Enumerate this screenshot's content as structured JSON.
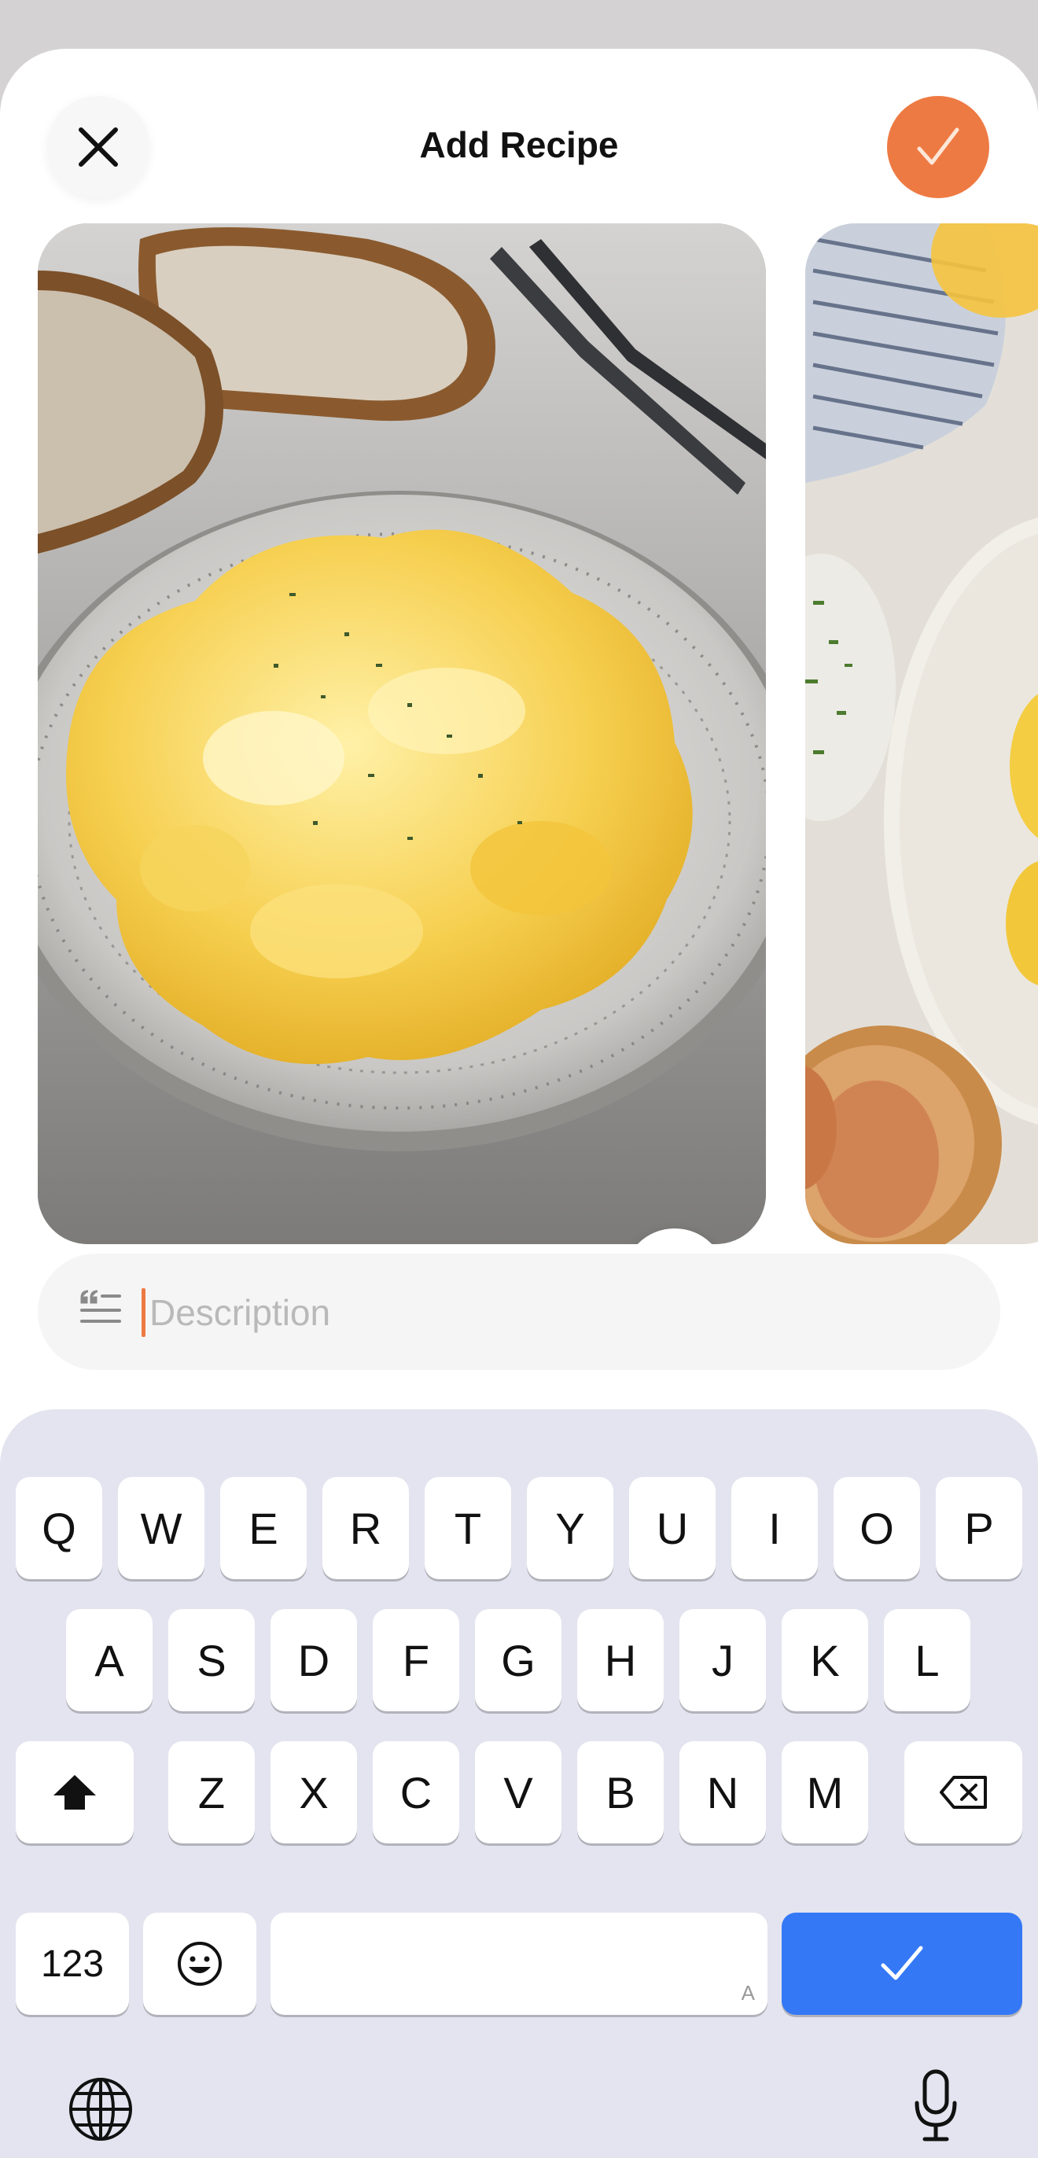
{
  "header": {
    "title": "Add Recipe",
    "close_icon": "close-icon",
    "confirm_icon": "checkmark-icon",
    "accent": "#ee7a43"
  },
  "photos": [
    {
      "subject": "scrambled eggs on plate"
    },
    {
      "subject": "scrambled eggs, chives, eggs"
    }
  ],
  "more_icon": "more-horizontal-icon",
  "description": {
    "icon": "text-quote-icon",
    "placeholder": "Description",
    "value": ""
  },
  "keyboard": {
    "row1": [
      "Q",
      "W",
      "E",
      "R",
      "T",
      "Y",
      "U",
      "I",
      "O",
      "P"
    ],
    "row2": [
      "A",
      "S",
      "D",
      "F",
      "G",
      "H",
      "J",
      "K",
      "L"
    ],
    "row3": [
      "Z",
      "X",
      "C",
      "V",
      "B",
      "N",
      "M"
    ],
    "numbers_label": "123",
    "space_hint": "A",
    "return_color": "#3478f6",
    "icons": [
      "shift-icon",
      "backspace-icon",
      "emoji-icon",
      "checkmark-icon",
      "globe-icon",
      "microphone-icon"
    ]
  }
}
